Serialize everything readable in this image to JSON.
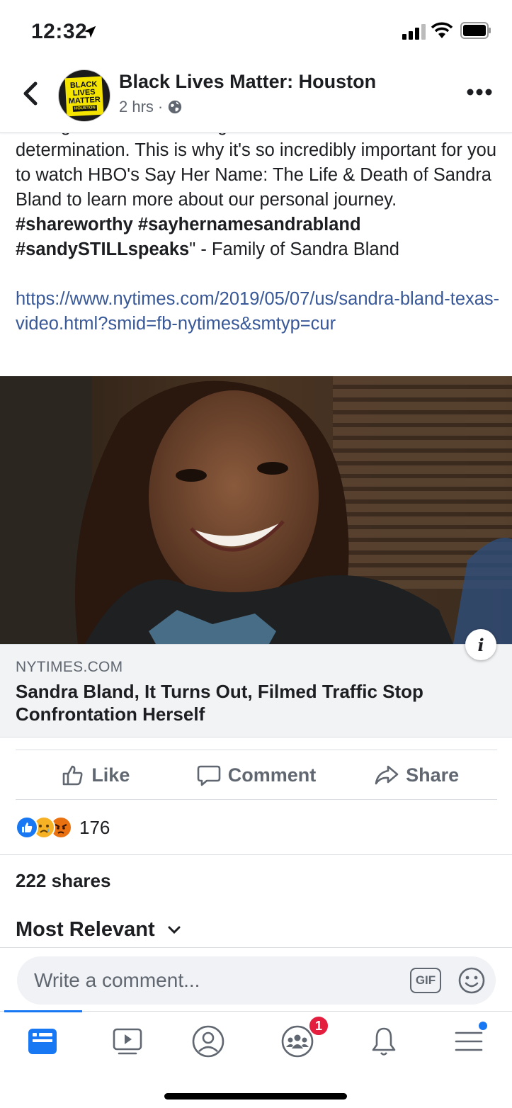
{
  "status_bar": {
    "time": "12:32"
  },
  "header": {
    "page_name": "Black Lives Matter: Houston",
    "time_ago": "2 hrs",
    "separator": "·",
    "avatar_text": {
      "line1": "BLACK",
      "line2": "LIVES",
      "line3": "MATTER",
      "line4": "HOUSTON"
    }
  },
  "post": {
    "partial_line": "managed to do that through sheer will and",
    "text_1": "determination. This is why it's so incredibly important for you to watch HBO's Say Her Name: The Life & Death of Sandra Bland to learn more about our personal journey. ",
    "hashtag_1": "#shareworthy",
    "hashtag_2": "#sayhernamesandrabland",
    "hashtag_3": "#sandySTILLspeaks",
    "text_2": "\" - Family of Sandra Bland",
    "link": "https://www.nytimes.com/2019/05/07/us/sandra-bland-texas-video.html?smid=fb-nytimes&smtyp=cur"
  },
  "preview": {
    "domain": "NYTIMES.COM",
    "title": "Sandra Bland, It Turns Out, Filmed Traffic Stop Confrontation Herself",
    "info_label": "i"
  },
  "actions": {
    "like": "Like",
    "comment": "Comment",
    "share": "Share"
  },
  "reactions": {
    "count": "176"
  },
  "shares": "222 shares",
  "sort": {
    "label": "Most Relevant"
  },
  "composer": {
    "placeholder": "Write a comment...",
    "gif": "GIF"
  },
  "tabbar": {
    "groups_badge": "1"
  },
  "colors": {
    "accent": "#1877f2",
    "link": "#385898",
    "badge": "#e41e3f"
  }
}
